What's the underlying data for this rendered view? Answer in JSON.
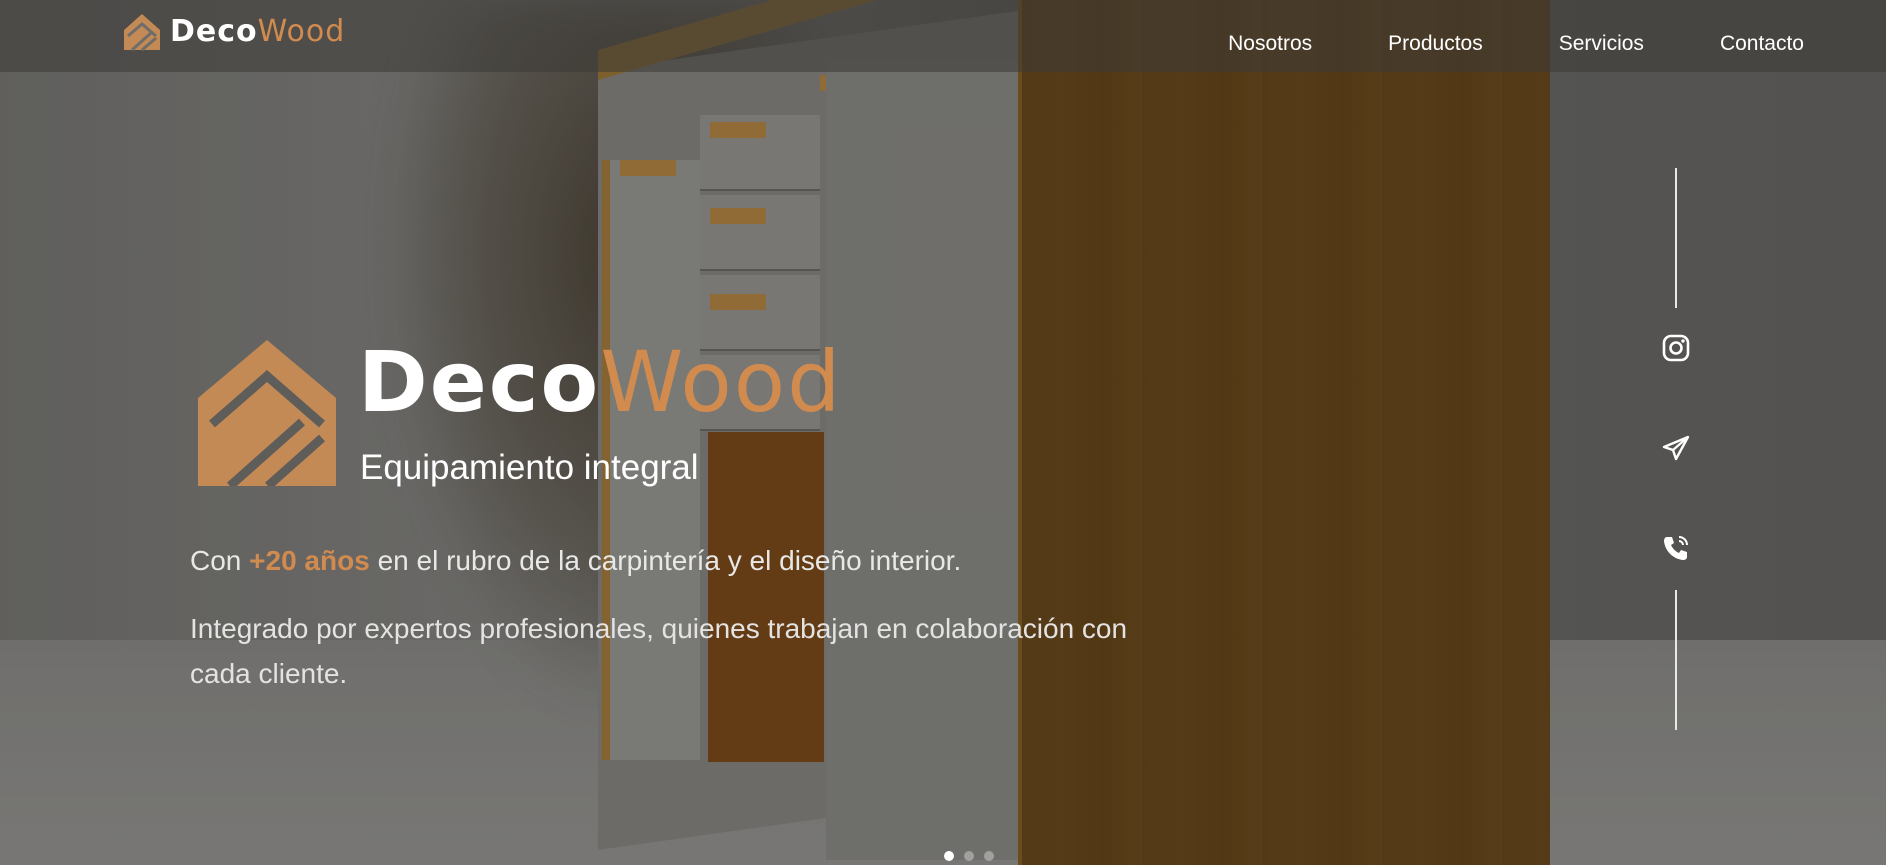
{
  "brand": {
    "part1": "Deco",
    "part2": "Wood"
  },
  "nav": [
    {
      "label": "Nosotros"
    },
    {
      "label": "Productos"
    },
    {
      "label": "Servicios"
    },
    {
      "label": "Contacto"
    }
  ],
  "hero": {
    "title_part1": "Deco",
    "title_part2": "Wood",
    "subtitle": "Equipamiento integral",
    "paragraph1_prefix": "Con ",
    "paragraph1_highlight": "+20 años",
    "paragraph1_suffix": " en el rubro de la carpintería y el diseño interior.",
    "paragraph2": "Integrado por expertos profesionales, quienes trabajan en colaboración con cada cliente."
  },
  "social": [
    {
      "icon": "instagram-icon"
    },
    {
      "icon": "telegram-icon"
    },
    {
      "icon": "phone-icon"
    }
  ],
  "slider": {
    "total_slides": 3,
    "active_slide": 1
  },
  "colors": {
    "accent": "#d18b4f",
    "text": "#ffffff"
  }
}
